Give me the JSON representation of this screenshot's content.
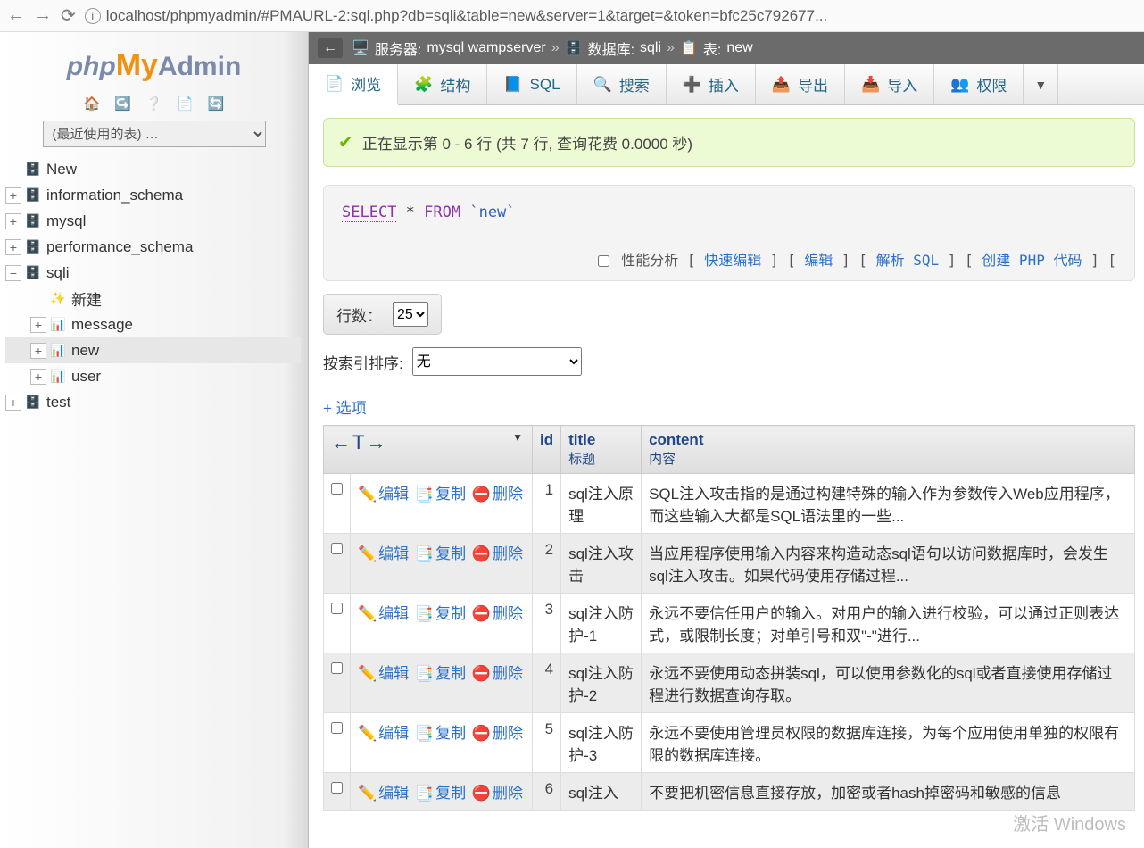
{
  "browser": {
    "url": "localhost/phpmyadmin/#PMAURL-2:sql.php?db=sqli&table=new&server=1&target=&token=bfc25c792677..."
  },
  "logo": {
    "p1": "php",
    "p2": "My",
    "p3": "Admin"
  },
  "sidebar": {
    "recent": "(最近使用的表) …",
    "nodes": [
      {
        "label": "New",
        "type": "db",
        "exp": ""
      },
      {
        "label": "information_schema",
        "type": "db",
        "exp": "+"
      },
      {
        "label": "mysql",
        "type": "db",
        "exp": "+"
      },
      {
        "label": "performance_schema",
        "type": "db",
        "exp": "+"
      },
      {
        "label": "sqli",
        "type": "db",
        "exp": "−",
        "children": [
          {
            "label": "新建",
            "type": "new"
          },
          {
            "label": "message",
            "type": "tbl",
            "exp": "+"
          },
          {
            "label": "new",
            "type": "tbl",
            "exp": "+",
            "selected": true
          },
          {
            "label": "user",
            "type": "tbl",
            "exp": "+"
          }
        ]
      },
      {
        "label": "test",
        "type": "db",
        "exp": "+"
      }
    ]
  },
  "breadcrumb": {
    "server_label": "服务器:",
    "server": "mysql wampserver",
    "db_label": "数据库:",
    "db": "sqli",
    "table_label": "表:",
    "table": "new"
  },
  "tabs": [
    {
      "label": "浏览",
      "icon": "📄",
      "active": true
    },
    {
      "label": "结构",
      "icon": "🧩"
    },
    {
      "label": "SQL",
      "icon": "📘"
    },
    {
      "label": "搜索",
      "icon": "🔍"
    },
    {
      "label": "插入",
      "icon": "➕"
    },
    {
      "label": "导出",
      "icon": "📤"
    },
    {
      "label": "导入",
      "icon": "📥"
    },
    {
      "label": "权限",
      "icon": "👥"
    }
  ],
  "success": "正在显示第 0 - 6 行 (共 7 行, 查询花费 0.0000 秒)",
  "sql": {
    "select": "SELECT",
    "star": " * ",
    "from": "FROM",
    "table": "`new`"
  },
  "sql_links": {
    "profile": "性能分析",
    "l1": "快速编辑",
    "l2": "编辑",
    "l3": "解析 SQL",
    "l4": "创建 PHP 代码"
  },
  "rows": {
    "label": "行数：",
    "value": "25"
  },
  "sort": {
    "label": "按索引排序:",
    "value": "无"
  },
  "options": "+ 选项",
  "headers": {
    "arrows": "←T→",
    "id": "id",
    "title": "title",
    "title_sub": "标题",
    "content": "content",
    "content_sub": "内容"
  },
  "action_labels": {
    "edit": "编辑",
    "copy": "复制",
    "delete": "删除"
  },
  "table_rows": [
    {
      "id": "1",
      "title": "sql注入原理",
      "content": "SQL注入攻击指的是通过构建特殊的输入作为参数传入Web应用程序，而这些输入大都是SQL语法里的一些..."
    },
    {
      "id": "2",
      "title": "sql注入攻击",
      "content": "当应用程序使用输入内容来构造动态sql语句以访问数据库时，会发生sql注入攻击。如果代码使用存储过程..."
    },
    {
      "id": "3",
      "title": "sql注入防护-1",
      "content": "永远不要信任用户的输入。对用户的输入进行校验，可以通过正则表达式，或限制长度；对单引号和双\"-\"进行..."
    },
    {
      "id": "4",
      "title": "sql注入防护-2",
      "content": "永远不要使用动态拼装sql，可以使用参数化的sql或者直接使用存储过程进行数据查询存取。"
    },
    {
      "id": "5",
      "title": "sql注入防护-3",
      "content": "永远不要使用管理员权限的数据库连接，为每个应用使用单独的权限有限的数据库连接。"
    },
    {
      "id": "6",
      "title": "sql注入",
      "content": "不要把机密信息直接存放，加密或者hash掉密码和敏感的信息"
    }
  ],
  "activate": "激活 Windows"
}
